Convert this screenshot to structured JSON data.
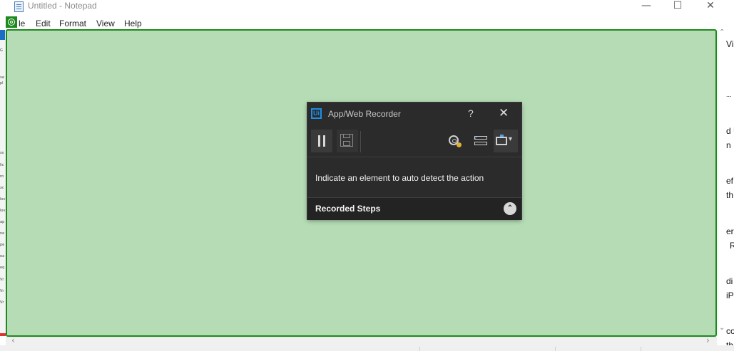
{
  "window": {
    "title": "Untitled - Notepad",
    "minimize": "—",
    "maximize": "☐",
    "close": "✕"
  },
  "menubar": {
    "items": [
      "le",
      "Edit",
      "Format",
      "View",
      "Help"
    ]
  },
  "right_fragments": [
    "Vi",
    "...",
    "d U",
    "n",
    "ef",
    "th",
    "er",
    "R",
    "di",
    "iP",
    "co",
    "th"
  ],
  "left_fragments": [
    "G",
    "ve",
    "pl",
    "ss",
    "lic",
    "ro",
    "xc",
    "lov",
    "lov",
    "ap",
    "ne",
    "pe",
    "ea",
    "eq",
    "Vr",
    "Vr",
    "Vr"
  ],
  "recorder": {
    "title": "App/Web Recorder",
    "logo": "Ui",
    "help": "?",
    "close": "✕",
    "message": "Indicate an element to auto detect the action",
    "steps_label": "Recorded Steps",
    "steps_toggle": "⌃",
    "more_arrow": "▾",
    "list_check": "✓"
  },
  "highlight": {
    "border_color": "#1e8a1e",
    "fill_color": "#b5dcb5"
  },
  "scroll": {
    "left_arrow": "‹",
    "right_arrow": "›",
    "up_arrow": "⌃",
    "down_arrow": "⌄"
  }
}
